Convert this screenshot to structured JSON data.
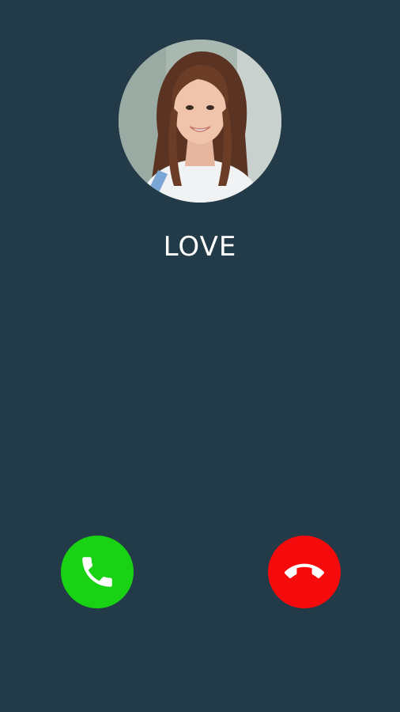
{
  "caller": {
    "name": "LOVE",
    "avatar_icon": "person-photo"
  },
  "actions": {
    "accept_icon": "phone-icon",
    "accept_color": "#19d213",
    "decline_icon": "phone-hangup-icon",
    "decline_color": "#f50b0b"
  },
  "colors": {
    "background": "#233b48",
    "text": "#ffffff"
  }
}
